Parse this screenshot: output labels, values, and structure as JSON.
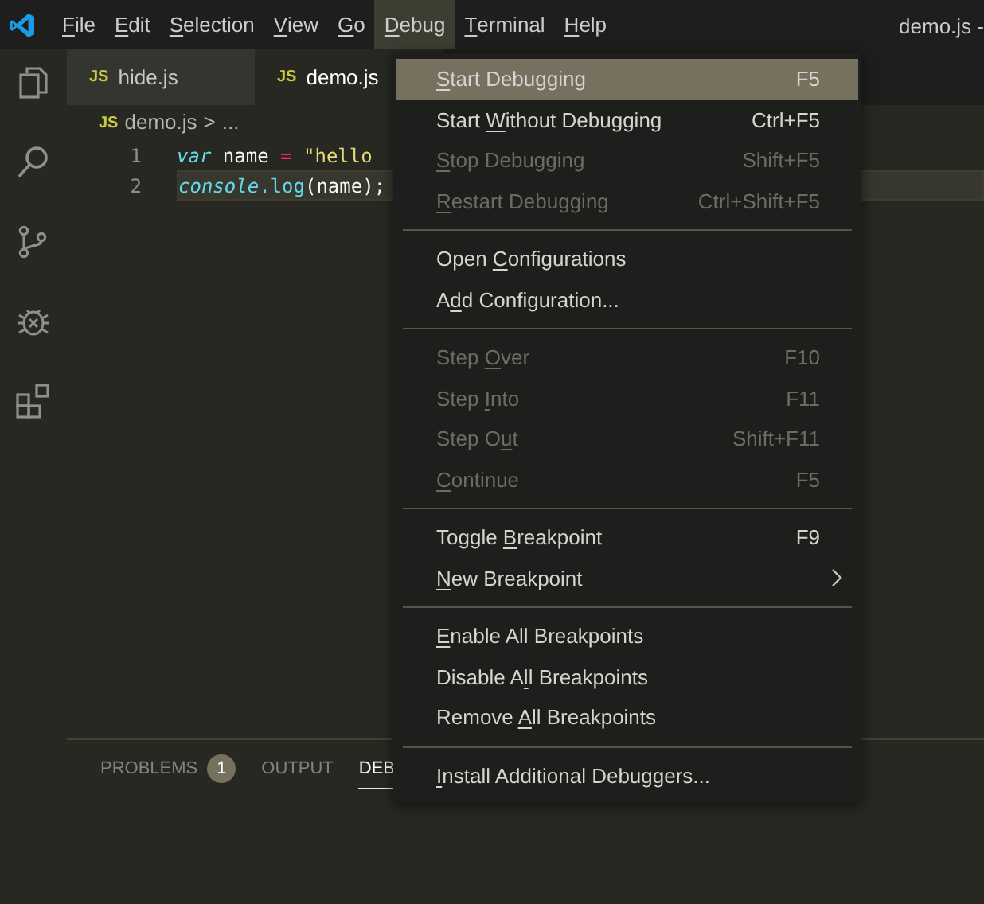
{
  "menubar": {
    "items": [
      {
        "key": "F",
        "post": "ile",
        "selected": false
      },
      {
        "key": "E",
        "post": "dit",
        "selected": false
      },
      {
        "key": "S",
        "post": "election",
        "selected": false
      },
      {
        "key": "V",
        "post": "iew",
        "selected": false
      },
      {
        "key": "G",
        "post": "o",
        "selected": false
      },
      {
        "key": "D",
        "post": "ebug",
        "selected": true
      },
      {
        "key": "T",
        "post": "erminal",
        "selected": false
      },
      {
        "key": "H",
        "post": "elp",
        "selected": false
      }
    ],
    "window_title": "demo.js -"
  },
  "tabs": [
    {
      "badge": "JS",
      "label": "hide.js",
      "selected": false
    },
    {
      "badge": "JS",
      "label": "demo.js",
      "selected": true
    }
  ],
  "breadcrumb": {
    "badge": "JS",
    "file": "demo.js",
    "separator": ">",
    "more": "..."
  },
  "editor": {
    "lines": [
      {
        "number": "1",
        "highlighted": false,
        "tokens": [
          {
            "kind": "keyword",
            "text": "var"
          },
          {
            "kind": "plain",
            "text": " name "
          },
          {
            "kind": "operator",
            "text": "="
          },
          {
            "kind": "string",
            "text": " \"hello"
          }
        ]
      },
      {
        "number": "2",
        "highlighted": true,
        "tokens": [
          {
            "kind": "keyword",
            "text": "console"
          },
          {
            "kind": "function",
            "text": ".log"
          },
          {
            "kind": "plain",
            "text": "(name);"
          }
        ]
      }
    ]
  },
  "panel": {
    "tabs": [
      {
        "label": "PROBLEMS",
        "badge": "1",
        "selected": false
      },
      {
        "label": "OUTPUT",
        "selected": false
      },
      {
        "label": "DEB",
        "selected": true
      }
    ]
  },
  "menu": {
    "items": [
      {
        "kind": "item",
        "key": "S",
        "post": "tart Debugging",
        "shortcut": "F5",
        "disabled": false,
        "selected": true,
        "submenu": false
      },
      {
        "kind": "item",
        "pre": "Start ",
        "key": "W",
        "post": "ithout Debugging",
        "shortcut": "Ctrl+F5",
        "disabled": false,
        "selected": false,
        "submenu": false
      },
      {
        "kind": "item",
        "key": "S",
        "post": "top Debugging",
        "shortcut": "Shift+F5",
        "disabled": true,
        "selected": false,
        "submenu": false
      },
      {
        "kind": "item",
        "key": "R",
        "post": "estart Debugging",
        "shortcut": "Ctrl+Shift+F5",
        "disabled": true,
        "selected": false,
        "submenu": false
      },
      {
        "kind": "separator"
      },
      {
        "kind": "item",
        "pre": "Open ",
        "key": "C",
        "post": "onfigurations",
        "disabled": false,
        "selected": false,
        "submenu": false
      },
      {
        "kind": "item",
        "pre": "A",
        "key": "d",
        "post": "d Configuration...",
        "disabled": false,
        "selected": false,
        "submenu": false
      },
      {
        "kind": "separator"
      },
      {
        "kind": "item",
        "pre": "Step ",
        "key": "O",
        "post": "ver",
        "shortcut": "F10",
        "disabled": true,
        "selected": false,
        "submenu": false
      },
      {
        "kind": "item",
        "pre": "Step ",
        "key": "I",
        "post": "nto",
        "shortcut": "F11",
        "disabled": true,
        "selected": false,
        "submenu": false
      },
      {
        "kind": "item",
        "pre": "Step O",
        "key": "u",
        "post": "t",
        "shortcut": "Shift+F11",
        "disabled": true,
        "selected": false,
        "submenu": false
      },
      {
        "kind": "item",
        "key": "C",
        "post": "ontinue",
        "shortcut": "F5",
        "disabled": true,
        "selected": false,
        "submenu": false
      },
      {
        "kind": "separator"
      },
      {
        "kind": "item",
        "pre": "Toggle ",
        "key": "B",
        "post": "reakpoint",
        "shortcut": "F9",
        "disabled": false,
        "selected": false,
        "submenu": false
      },
      {
        "kind": "item",
        "key": "N",
        "post": "ew Breakpoint",
        "disabled": false,
        "selected": false,
        "submenu": true
      },
      {
        "kind": "separator"
      },
      {
        "kind": "item",
        "key": "E",
        "post": "nable All Breakpoints",
        "disabled": false,
        "selected": false,
        "submenu": false
      },
      {
        "kind": "item",
        "pre": "Disable A",
        "key": "l",
        "post": "l Breakpoints",
        "disabled": false,
        "selected": false,
        "submenu": false
      },
      {
        "kind": "item",
        "pre": "Remove ",
        "key": "A",
        "post": "ll Breakpoints",
        "disabled": false,
        "selected": false,
        "submenu": false
      },
      {
        "kind": "separator"
      },
      {
        "kind": "item",
        "key": "I",
        "post": "nstall Additional Debuggers...",
        "disabled": false,
        "selected": false,
        "submenu": false
      }
    ]
  }
}
